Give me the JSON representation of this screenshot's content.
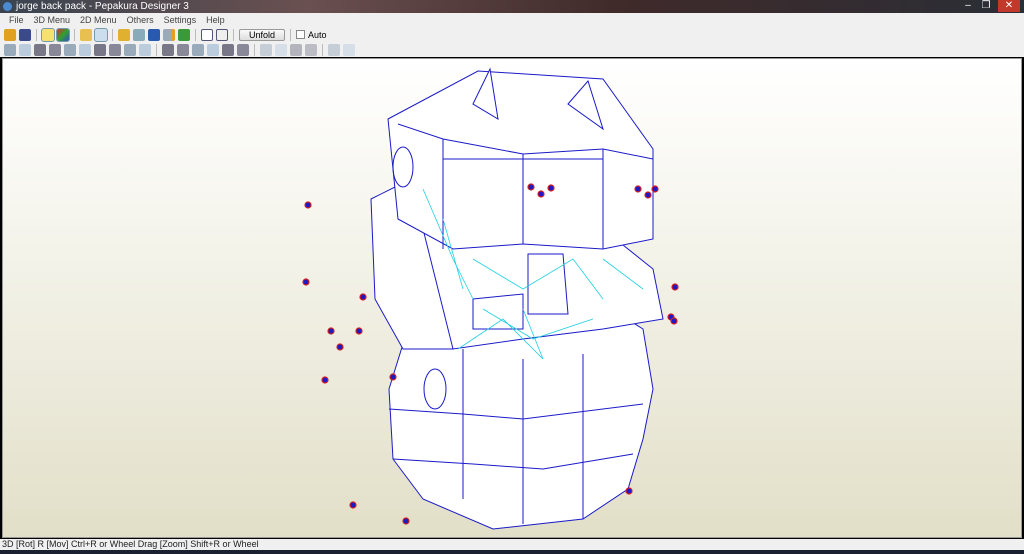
{
  "window": {
    "title": "jorge back pack - Pepakura Designer 3",
    "min": "–",
    "max": "❐",
    "close": "✕"
  },
  "menu": [
    "File",
    "3D Menu",
    "2D Menu",
    "Others",
    "Settings",
    "Help"
  ],
  "toolbar": {
    "unfold_label": "Unfold",
    "auto_label": "Auto",
    "row1_icons": [
      "open-icon",
      "save-icon",
      "light-icon",
      "color-icon",
      "texture-icon",
      "edge-icon",
      "pencil-icon",
      "cylinder-icon",
      "anchor-icon",
      "book-icon",
      "cube-icon",
      "single-pane-icon",
      "dual-pane-icon"
    ],
    "row2_icons": [
      "select-icon",
      "pointer-icon",
      "edit-icon",
      "join-icon",
      "paper-icon",
      "book2-icon",
      "flap-icon",
      "rotate-icon",
      "move-icon",
      "redo-icon",
      "fit-icon",
      "arrange-icon",
      "text-icon",
      "image-icon",
      "page-icon",
      "print-icon",
      "align-left-icon",
      "align-center-icon",
      "align-top-icon",
      "align-bottom-icon",
      "zoom-in-icon",
      "zoom-out-icon"
    ]
  },
  "status": "3D [Rot] R [Mov] Ctrl+R or Wheel Drag [Zoom] Shift+R or Wheel",
  "colors": {
    "edge": "#1a1ac8",
    "fold": "#20d0e0",
    "marker": "#d02020"
  }
}
